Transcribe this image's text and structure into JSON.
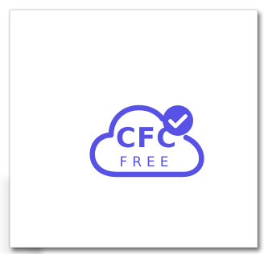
{
  "logo": {
    "primary_text": "CFC",
    "secondary_text": "FREE",
    "badge_icon": "checkmark-icon",
    "shape": "cloud-icon",
    "color": "#5751e6"
  }
}
